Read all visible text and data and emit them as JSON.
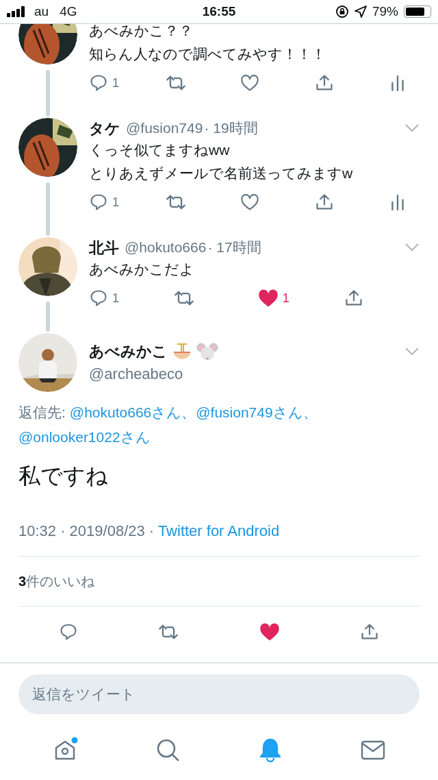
{
  "status_bar": {
    "carrier": "au",
    "network": "4G",
    "time": "16:55",
    "battery": "79%"
  },
  "thread": [
    {
      "lines": [
        "あべみかこ？？",
        "知らん人なので調べてみやす！！！"
      ],
      "actions": [
        {
          "kind": "reply",
          "count": "1"
        },
        {
          "kind": "retweet"
        },
        {
          "kind": "like",
          "liked": false
        },
        {
          "kind": "share"
        },
        {
          "kind": "analytics"
        }
      ]
    },
    {
      "name": "タケ",
      "handle": "@fusion749",
      "time": "· 19時間",
      "lines": [
        "くっそ似てますねww",
        "とりあえずメールで名前送ってみますw"
      ],
      "actions": [
        {
          "kind": "reply",
          "count": "1"
        },
        {
          "kind": "retweet"
        },
        {
          "kind": "like",
          "liked": false
        },
        {
          "kind": "share"
        },
        {
          "kind": "analytics"
        }
      ]
    },
    {
      "name": "北斗",
      "handle": "@hokuto666",
      "time": "· 17時間",
      "lines": [
        "あべみかこだよ"
      ],
      "actions": [
        {
          "kind": "reply",
          "count": "1"
        },
        {
          "kind": "retweet"
        },
        {
          "kind": "like",
          "liked": true,
          "count": "1"
        },
        {
          "kind": "share"
        }
      ]
    }
  ],
  "main_tweet": {
    "name": "あべみかこ",
    "handle": "@archeabeco",
    "reply_label": "返信先:",
    "mentions": [
      "@hokuto666さん、",
      "@fusion749さん、",
      "@onlooker1022さん"
    ],
    "body": "私ですね",
    "timestamp": "10:32 · 2019/08/23 · ",
    "source": "Twitter for Android",
    "likes_count": "3",
    "likes_label": "件のいいね",
    "actions": [
      {
        "kind": "reply"
      },
      {
        "kind": "retweet"
      },
      {
        "kind": "like",
        "liked": true
      },
      {
        "kind": "share"
      }
    ]
  },
  "reply_field": {
    "placeholder": "返信をツイート"
  },
  "tabs": [
    {
      "kind": "home",
      "badge": true,
      "selected": false
    },
    {
      "kind": "search",
      "badge": false,
      "selected": false
    },
    {
      "kind": "notifications",
      "badge": false,
      "selected": true
    },
    {
      "kind": "messages",
      "badge": false,
      "selected": false
    }
  ]
}
